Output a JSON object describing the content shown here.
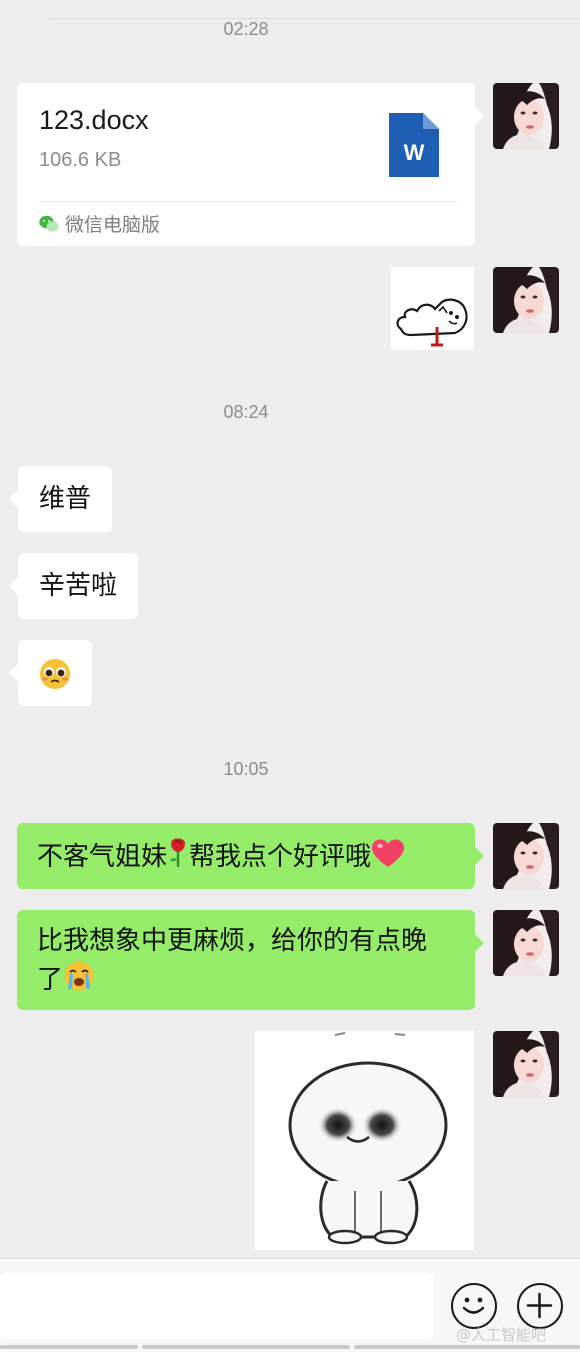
{
  "top_line_color": "#dcdcdc",
  "timestamps": [
    "02:28",
    "08:24",
    "10:05"
  ],
  "file_message": {
    "name": "123.docx",
    "size": "106.6 KB",
    "source": "微信电脑版",
    "file_icon": "word-doc-icon",
    "file_icon_letter": "W",
    "file_icon_color": "#1e5fb4"
  },
  "incoming_messages": [
    {
      "text": "维普"
    },
    {
      "text": "辛苦啦"
    },
    {
      "emoji": "pleading-face-emoji"
    }
  ],
  "outgoing_messages": [
    {
      "text_before": "不客气姐妹",
      "emoji_1": "rose-emoji",
      "text_after": "帮我点个好评哦",
      "emoji_2": "heart-emoji"
    },
    {
      "line1": "比我想象中更麻烦，给你的有点晚",
      "line2_text": "了",
      "emoji": "crying-face-emoji"
    }
  ],
  "stickers": [
    "bird-sticker",
    "ghost-sticker"
  ],
  "avatar": "avatar-girl-image",
  "bottom_bar": {
    "emoji_button": "emoji-button-icon",
    "plus_button": "plus-icon",
    "watermark": "@人工智能吧"
  },
  "colors": {
    "background": "#ededed",
    "bubble_in": "#ffffff",
    "bubble_out": "#95ec69",
    "timestamp_text": "#8c8c8c"
  }
}
